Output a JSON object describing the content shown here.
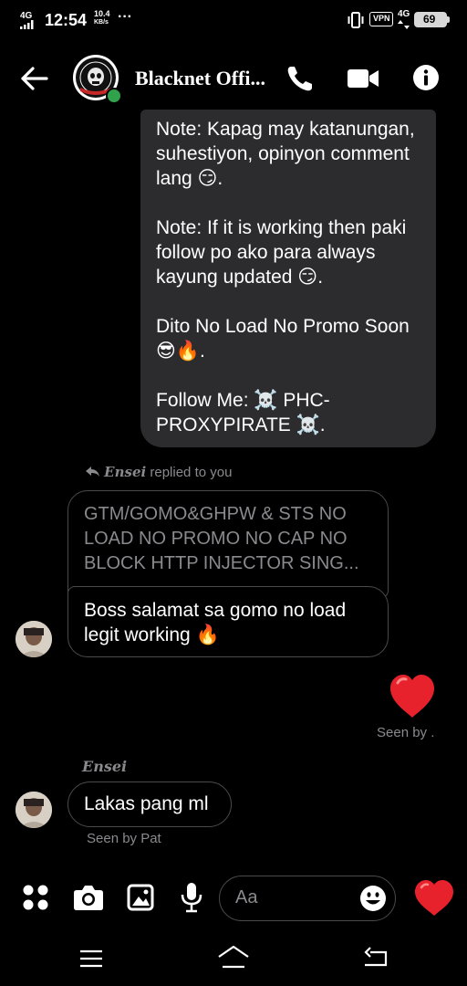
{
  "status_bar": {
    "network": "4G",
    "time": "12:54",
    "speed_value": "10.4",
    "speed_unit": "KB/s",
    "more": "···",
    "vpn_label": "VPN",
    "network_right": "4G",
    "battery": "69"
  },
  "header": {
    "title": "Blacknet Offi...",
    "status": "online",
    "colors": {
      "online": "#31a24c"
    }
  },
  "messages": {
    "incoming_long": {
      "paragraphs": [
        "Note: Kapag may katanungan, suhestiyon, opinyon comment lang 😏.",
        "Note: If it is working then paki follow po ako para always kayung updated 😏.",
        "Dito No Load No Promo Soon 😎🔥.",
        "Follow Me: ☠️ PHC-PROXYPIRATE ☠️."
      ]
    },
    "reply_meta": {
      "name": "Ensei",
      "text": "replied to you"
    },
    "quoted_text": "GTM/GOMO&GHPW & STS NO LOAD NO PROMO NO CAP NO BLOCK HTTP INJECTOR SING...",
    "reply_text": "Boss salamat sa gomo no load legit working 🔥",
    "sent_heart": "❤",
    "seen_by_1": "Seen by .",
    "sender_name": "Ensei",
    "lakas_text": "Lakas pang ml",
    "seen_by_2": "Seen by Pat"
  },
  "composer": {
    "placeholder": "Aa",
    "icons": [
      "apps-icon",
      "camera-icon",
      "gallery-icon",
      "microphone-icon",
      "emoji-icon",
      "like-heart-icon"
    ],
    "colors": {
      "heart": "#e8222c"
    }
  },
  "nav_bar": {
    "buttons": [
      "menu-icon",
      "home-icon",
      "back-icon"
    ]
  }
}
